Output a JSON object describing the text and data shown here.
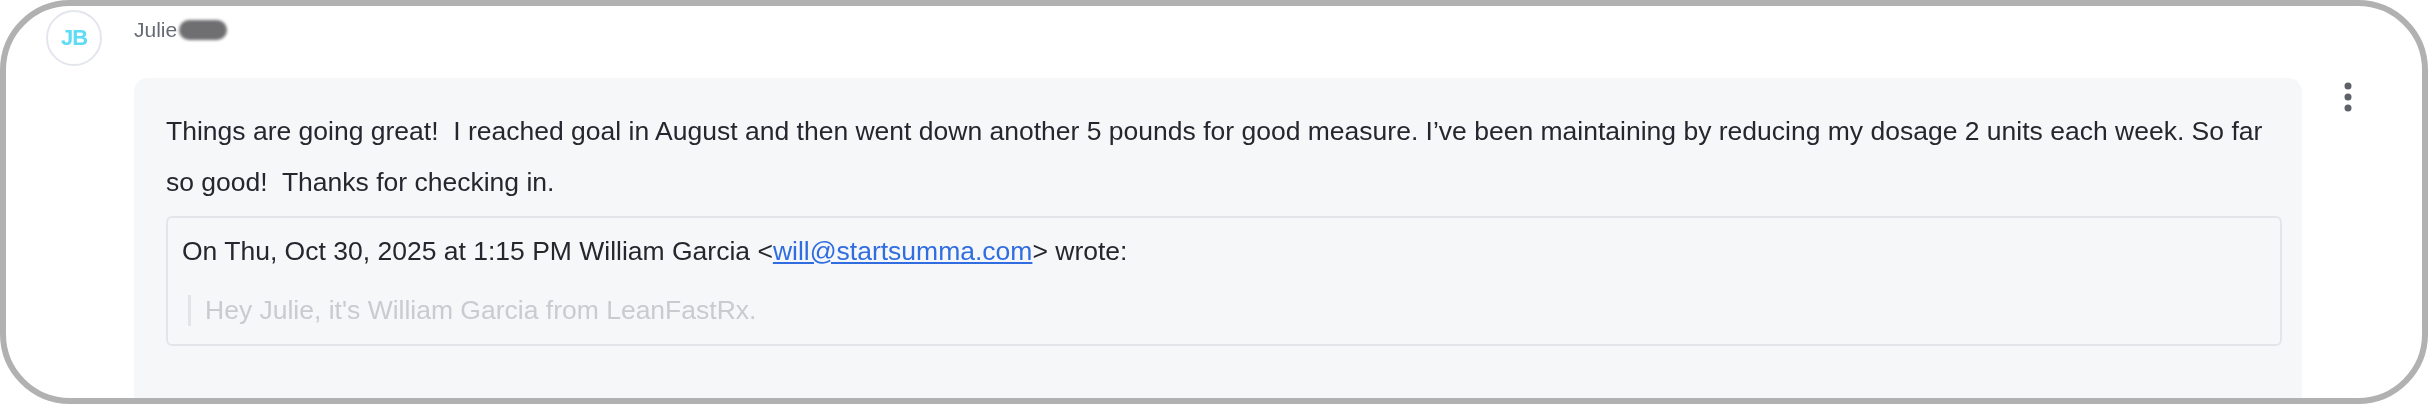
{
  "message": {
    "avatar_initials": "JB",
    "sender": "Julie",
    "sender_redacted": true,
    "body": "Things are going great!  I reached goal in August and then went down another 5 pounds for good measure. I’ve been maintaining by reducing my dosage 2 units each week. So far so good!  Thanks for checking in.",
    "quote": {
      "header_before": "On Thu, Oct 30, 2025 at 1:15 PM William Garcia <",
      "email": "will@startsumma.com",
      "header_after": "> wrote:",
      "lines": [
        "Hey Julie, it's William Garcia from LeanFastRx."
      ]
    }
  }
}
